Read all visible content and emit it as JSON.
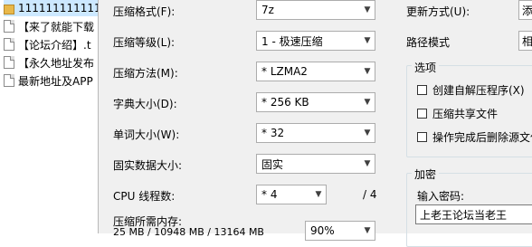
{
  "file_list": {
    "items": [
      {
        "label": "1111111111111",
        "icon": "folder-icon",
        "selected": true
      },
      {
        "label": "【来了就能下载",
        "icon": "document-icon",
        "selected": false
      },
      {
        "label": "【论坛介绍】.t",
        "icon": "document-icon",
        "selected": false
      },
      {
        "label": "【永久地址发布",
        "icon": "document-icon",
        "selected": false
      },
      {
        "label": "最新地址及APP",
        "icon": "document-icon",
        "selected": false
      }
    ]
  },
  "archive": {
    "format_label": "压缩格式(F):",
    "format_value": "7z",
    "level_label": "压缩等级(L):",
    "level_value": "1 - 极速压缩",
    "method_label": "压缩方法(M):",
    "method_value": "* LZMA2",
    "dict_label": "字典大小(D):",
    "dict_value": "* 256 KB",
    "word_label": "单词大小(W):",
    "word_value": "* 32",
    "solid_label": "固实数据大小:",
    "solid_value": "固实",
    "cpu_label": "CPU 线程数:",
    "cpu_value": "* 4",
    "cpu_total": "/ 4",
    "mem_label": "压缩所需内存:",
    "mem_detail": "25 MB / 10948 MB / 13164 MB",
    "mem_percent": "90%"
  },
  "right_panel": {
    "update_label": "更新方式(U):",
    "update_value": "添",
    "path_label": "路径模式",
    "path_value": "相",
    "options_title": "选项",
    "options": [
      {
        "label": "创建自解压程序(X)",
        "checked": false
      },
      {
        "label": "压缩共享文件",
        "checked": false
      },
      {
        "label": "操作完成后删除源文件",
        "checked": false
      }
    ],
    "encrypt_title": "加密",
    "password_label": "输入密码:",
    "password_value": "上老王论坛当老王"
  }
}
